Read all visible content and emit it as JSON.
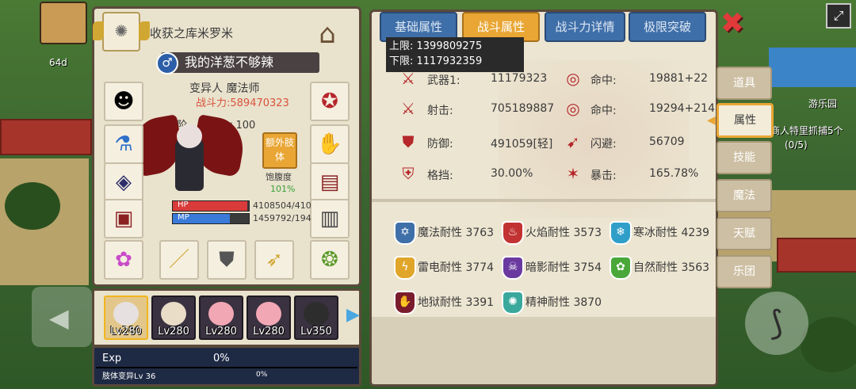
{
  "title": "收获之库米罗米",
  "player": {
    "name": "我的洋葱不够辣",
    "class": "变异人 魔法师",
    "power": "战斗力:589470323",
    "rank": "S阶 ... 徒: Lv 100",
    "hp_label": "HP",
    "mp_label": "MP",
    "hp_value": "4108504/410",
    "mp_value": "1459792/194",
    "hp_fraction": 0.98,
    "mp_fraction": 0.75
  },
  "extra_limb": "额外肢体",
  "satiety": {
    "label": "饱腹度",
    "value": "101%"
  },
  "pets": [
    {
      "level": "Lv280",
      "color": "#e6e0e0"
    },
    {
      "level": "Lv280",
      "color": "#e9ddc7"
    },
    {
      "level": "Lv280",
      "color": "#f2a7b5"
    },
    {
      "level": "Lv280",
      "color": "#f2a7b5"
    },
    {
      "level": "Lv350",
      "color": "#2d2d2d"
    }
  ],
  "exp": {
    "label": "Exp",
    "value": "0%",
    "sub_label": "肢体变异Lv 36",
    "sub_value": "0%"
  },
  "tabs": [
    "基础属性",
    "战斗属性",
    "战斗力详情",
    "极限突破"
  ],
  "tooltip": {
    "upper": "上限: 1399809275",
    "lower": "下限: 1117932359"
  },
  "stats": {
    "weapon": {
      "label": "武器1:",
      "value": "11179323"
    },
    "hit1": {
      "label": "命中:",
      "value": "19881+22"
    },
    "shoot": {
      "label": "射击:",
      "value": "705189887"
    },
    "hit2": {
      "label": "命中:",
      "value": "19294+214"
    },
    "defense": {
      "label": "防御:",
      "value": "491059[轻]"
    },
    "dodge": {
      "label": "闪避:",
      "value": "56709"
    },
    "block": {
      "label": "格挡:",
      "value": "30.00%"
    },
    "crit": {
      "label": "暴击:",
      "value": "165.78%"
    }
  },
  "resist": [
    {
      "name": "魔法耐性",
      "value": "3763",
      "color": "#3f6fa8",
      "icon": "✡"
    },
    {
      "name": "火焰耐性",
      "value": "3573",
      "color": "#c23232",
      "icon": "♨"
    },
    {
      "name": "寒冰耐性",
      "value": "4239",
      "color": "#2f9fc9",
      "icon": "❄"
    },
    {
      "name": "雷电耐性",
      "value": "3774",
      "color": "#e0a62a",
      "icon": "ϟ"
    },
    {
      "name": "暗影耐性",
      "value": "3754",
      "color": "#6a3aa0",
      "icon": "☠"
    },
    {
      "name": "自然耐性",
      "value": "3563",
      "color": "#4aa83a",
      "icon": "✿"
    },
    {
      "name": "地狱耐性",
      "value": "3391",
      "color": "#7a1c2c",
      "icon": "✋"
    },
    {
      "name": "精神耐性",
      "value": "3870",
      "color": "#3aa89c",
      "icon": "✺"
    }
  ],
  "side_tabs": [
    "道具",
    "属性",
    "技能",
    "魔法",
    "天赋",
    "乐团"
  ],
  "hud": {
    "level": "64d",
    "place": "游乐园",
    "quest": "商人特里抓捕5个",
    "quest_progress": "(0/5)"
  }
}
